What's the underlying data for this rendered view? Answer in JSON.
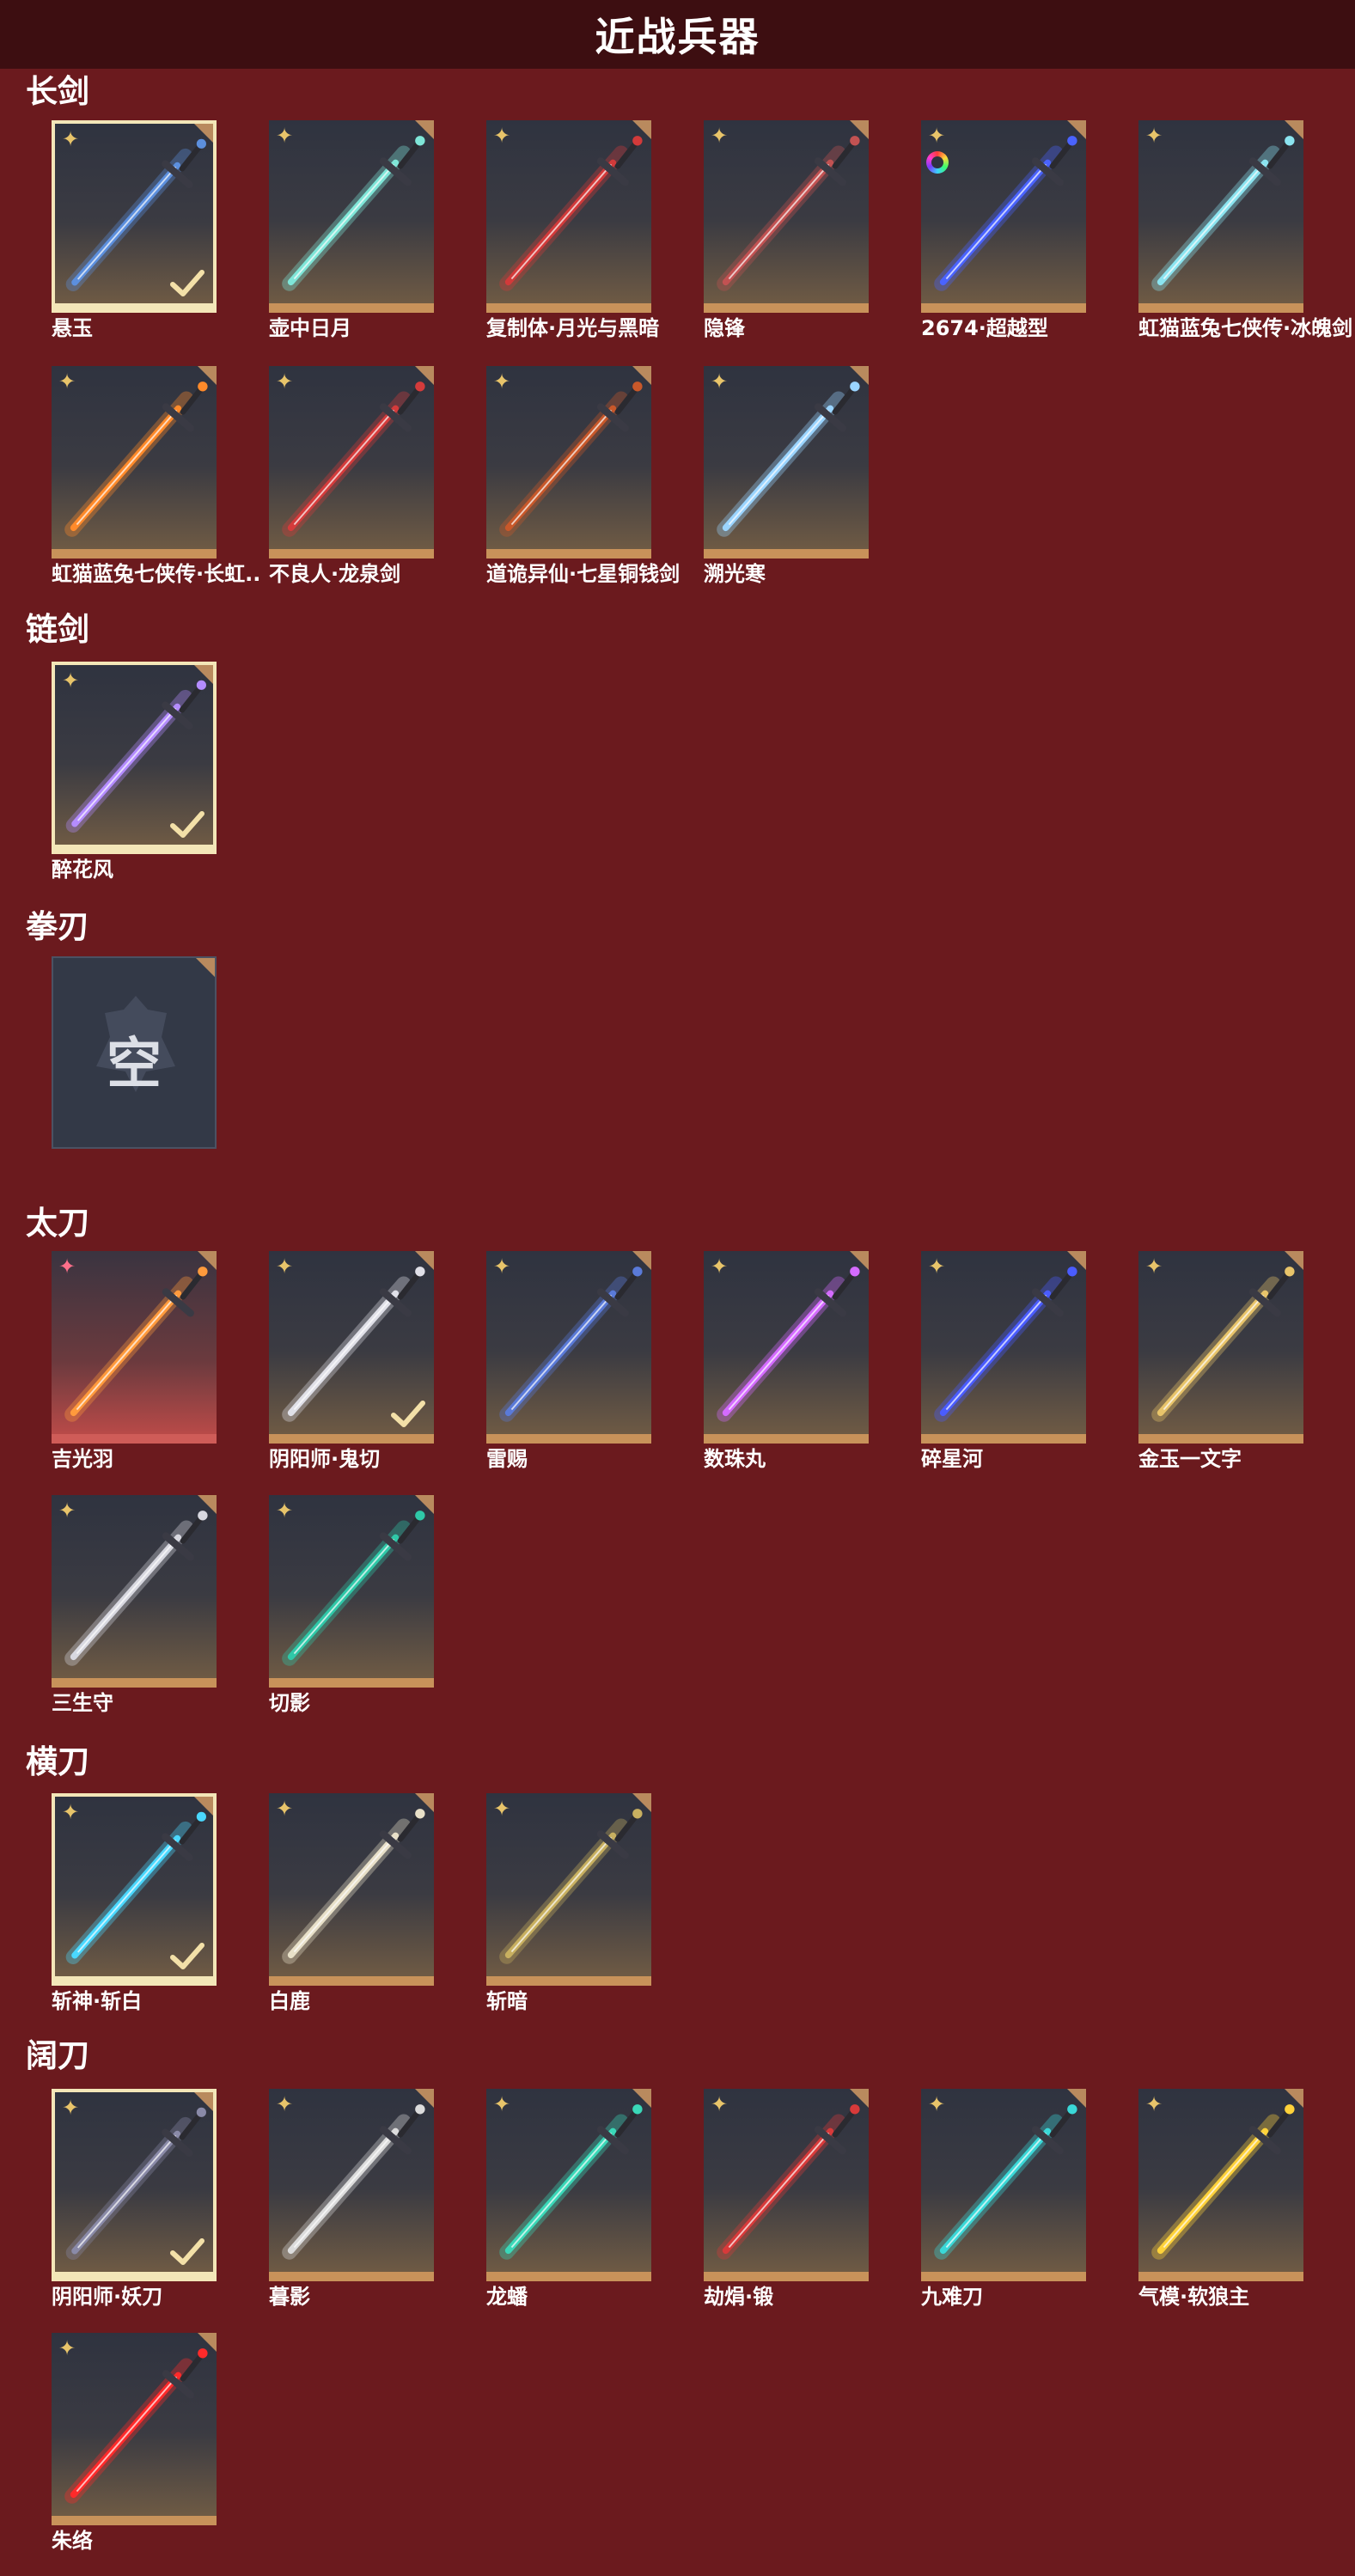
{
  "header": {
    "title": "近战兵器"
  },
  "sections": [
    {
      "title": "长剑",
      "items": [
        {
          "name": "悬玉",
          "selected": true,
          "color": "#5c8fdd"
        },
        {
          "name": "壶中日月",
          "color": "#7fe6d8"
        },
        {
          "name": "复制体·月光与黑暗",
          "color": "#d23a3a"
        },
        {
          "name": "隐锋",
          "color": "#c25252"
        },
        {
          "name": "2674·超越型",
          "ring": true,
          "color": "#4a63ff"
        },
        {
          "name": "虹猫蓝兔七侠传·冰魄剑",
          "color": "#8be4f0"
        },
        {
          "name": "虹猫蓝兔七侠传·长虹剑",
          "display": "虹猫蓝兔七侠传·长虹..",
          "color": "#ff8a2a"
        },
        {
          "name": "不良人·龙泉剑",
          "color": "#d43b3b"
        },
        {
          "name": "道诡异仙·七星铜钱剑",
          "color": "#c8582a"
        },
        {
          "name": "溯光寒",
          "color": "#9ad4ff"
        }
      ]
    },
    {
      "title": "链剑",
      "items": [
        {
          "name": "醉花风",
          "selected": true,
          "color": "#b48cff"
        }
      ]
    },
    {
      "title": "拳刃",
      "items": [
        {
          "name": "",
          "empty": true,
          "empty_label": "空"
        }
      ]
    },
    {
      "title": "太刀",
      "items": [
        {
          "name": "吉光羽",
          "red": true,
          "color": "#ff9a3c"
        },
        {
          "name": "阴阳师·鬼切",
          "selected_check": true,
          "color": "#e0e0e8"
        },
        {
          "name": "雷赐",
          "color": "#5a7ad8"
        },
        {
          "name": "数珠丸",
          "color": "#d46bff"
        },
        {
          "name": "碎星河",
          "color": "#4a5cff"
        },
        {
          "name": "金玉一文字",
          "color": "#e8c46a"
        },
        {
          "name": "三生守",
          "color": "#d8d8e0"
        },
        {
          "name": "切影",
          "color": "#2fc8a8"
        }
      ]
    },
    {
      "title": "横刀",
      "items": [
        {
          "name": "斩神·斩白",
          "selected": true,
          "color": "#4ad8ff"
        },
        {
          "name": "白鹿",
          "color": "#e8e0c8"
        },
        {
          "name": "斩暗",
          "color": "#c8b060"
        }
      ]
    },
    {
      "title": "阔刀",
      "items": [
        {
          "name": "阴阳师·妖刀",
          "selected": true,
          "color": "#8a8aa8"
        },
        {
          "name": "暮影",
          "color": "#dcdcdc"
        },
        {
          "name": "龙蟠",
          "color": "#3ad8b8"
        },
        {
          "name": "劫焆·锻",
          "color": "#d83a3a"
        },
        {
          "name": "九难刀",
          "color": "#3ad8d8"
        },
        {
          "name": "气模·软狼主",
          "color": "#ffd23a"
        },
        {
          "name": "朱络",
          "color": "#ff2a2a"
        }
      ]
    }
  ]
}
